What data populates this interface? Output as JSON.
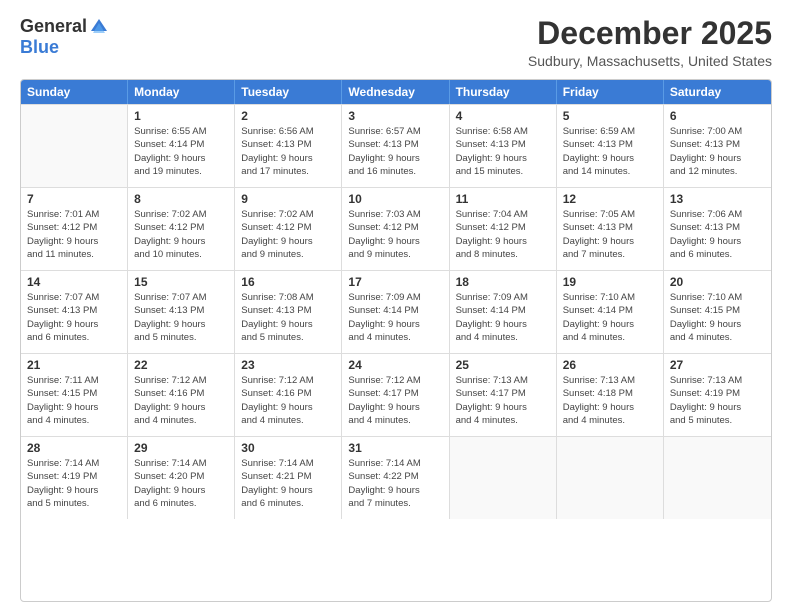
{
  "header": {
    "logo_general": "General",
    "logo_blue": "Blue",
    "month_title": "December 2025",
    "location": "Sudbury, Massachusetts, United States"
  },
  "calendar": {
    "days_of_week": [
      "Sunday",
      "Monday",
      "Tuesday",
      "Wednesday",
      "Thursday",
      "Friday",
      "Saturday"
    ],
    "rows": [
      [
        {
          "day": "",
          "info": "",
          "empty": true
        },
        {
          "day": "1",
          "info": "Sunrise: 6:55 AM\nSunset: 4:14 PM\nDaylight: 9 hours\nand 19 minutes."
        },
        {
          "day": "2",
          "info": "Sunrise: 6:56 AM\nSunset: 4:13 PM\nDaylight: 9 hours\nand 17 minutes."
        },
        {
          "day": "3",
          "info": "Sunrise: 6:57 AM\nSunset: 4:13 PM\nDaylight: 9 hours\nand 16 minutes."
        },
        {
          "day": "4",
          "info": "Sunrise: 6:58 AM\nSunset: 4:13 PM\nDaylight: 9 hours\nand 15 minutes."
        },
        {
          "day": "5",
          "info": "Sunrise: 6:59 AM\nSunset: 4:13 PM\nDaylight: 9 hours\nand 14 minutes."
        },
        {
          "day": "6",
          "info": "Sunrise: 7:00 AM\nSunset: 4:13 PM\nDaylight: 9 hours\nand 12 minutes."
        }
      ],
      [
        {
          "day": "7",
          "info": "Sunrise: 7:01 AM\nSunset: 4:12 PM\nDaylight: 9 hours\nand 11 minutes."
        },
        {
          "day": "8",
          "info": "Sunrise: 7:02 AM\nSunset: 4:12 PM\nDaylight: 9 hours\nand 10 minutes."
        },
        {
          "day": "9",
          "info": "Sunrise: 7:02 AM\nSunset: 4:12 PM\nDaylight: 9 hours\nand 9 minutes."
        },
        {
          "day": "10",
          "info": "Sunrise: 7:03 AM\nSunset: 4:12 PM\nDaylight: 9 hours\nand 9 minutes."
        },
        {
          "day": "11",
          "info": "Sunrise: 7:04 AM\nSunset: 4:12 PM\nDaylight: 9 hours\nand 8 minutes."
        },
        {
          "day": "12",
          "info": "Sunrise: 7:05 AM\nSunset: 4:13 PM\nDaylight: 9 hours\nand 7 minutes."
        },
        {
          "day": "13",
          "info": "Sunrise: 7:06 AM\nSunset: 4:13 PM\nDaylight: 9 hours\nand 6 minutes."
        }
      ],
      [
        {
          "day": "14",
          "info": "Sunrise: 7:07 AM\nSunset: 4:13 PM\nDaylight: 9 hours\nand 6 minutes."
        },
        {
          "day": "15",
          "info": "Sunrise: 7:07 AM\nSunset: 4:13 PM\nDaylight: 9 hours\nand 5 minutes."
        },
        {
          "day": "16",
          "info": "Sunrise: 7:08 AM\nSunset: 4:13 PM\nDaylight: 9 hours\nand 5 minutes."
        },
        {
          "day": "17",
          "info": "Sunrise: 7:09 AM\nSunset: 4:14 PM\nDaylight: 9 hours\nand 4 minutes."
        },
        {
          "day": "18",
          "info": "Sunrise: 7:09 AM\nSunset: 4:14 PM\nDaylight: 9 hours\nand 4 minutes."
        },
        {
          "day": "19",
          "info": "Sunrise: 7:10 AM\nSunset: 4:14 PM\nDaylight: 9 hours\nand 4 minutes."
        },
        {
          "day": "20",
          "info": "Sunrise: 7:10 AM\nSunset: 4:15 PM\nDaylight: 9 hours\nand 4 minutes."
        }
      ],
      [
        {
          "day": "21",
          "info": "Sunrise: 7:11 AM\nSunset: 4:15 PM\nDaylight: 9 hours\nand 4 minutes."
        },
        {
          "day": "22",
          "info": "Sunrise: 7:12 AM\nSunset: 4:16 PM\nDaylight: 9 hours\nand 4 minutes."
        },
        {
          "day": "23",
          "info": "Sunrise: 7:12 AM\nSunset: 4:16 PM\nDaylight: 9 hours\nand 4 minutes."
        },
        {
          "day": "24",
          "info": "Sunrise: 7:12 AM\nSunset: 4:17 PM\nDaylight: 9 hours\nand 4 minutes."
        },
        {
          "day": "25",
          "info": "Sunrise: 7:13 AM\nSunset: 4:17 PM\nDaylight: 9 hours\nand 4 minutes."
        },
        {
          "day": "26",
          "info": "Sunrise: 7:13 AM\nSunset: 4:18 PM\nDaylight: 9 hours\nand 4 minutes."
        },
        {
          "day": "27",
          "info": "Sunrise: 7:13 AM\nSunset: 4:19 PM\nDaylight: 9 hours\nand 5 minutes."
        }
      ],
      [
        {
          "day": "28",
          "info": "Sunrise: 7:14 AM\nSunset: 4:19 PM\nDaylight: 9 hours\nand 5 minutes."
        },
        {
          "day": "29",
          "info": "Sunrise: 7:14 AM\nSunset: 4:20 PM\nDaylight: 9 hours\nand 6 minutes."
        },
        {
          "day": "30",
          "info": "Sunrise: 7:14 AM\nSunset: 4:21 PM\nDaylight: 9 hours\nand 6 minutes."
        },
        {
          "day": "31",
          "info": "Sunrise: 7:14 AM\nSunset: 4:22 PM\nDaylight: 9 hours\nand 7 minutes."
        },
        {
          "day": "",
          "info": "",
          "empty": true
        },
        {
          "day": "",
          "info": "",
          "empty": true
        },
        {
          "day": "",
          "info": "",
          "empty": true
        }
      ]
    ]
  }
}
